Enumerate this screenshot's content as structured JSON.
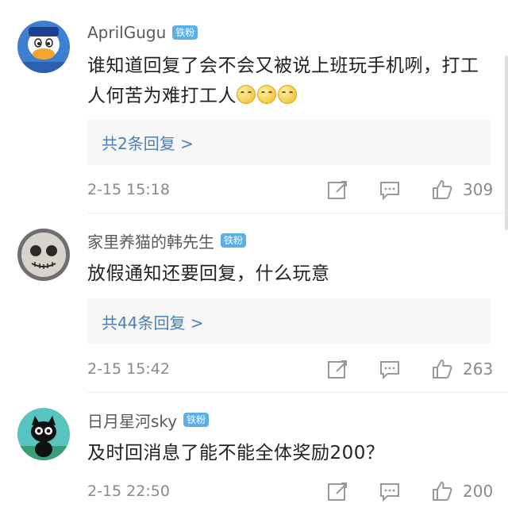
{
  "comments": [
    {
      "user": "AprilGugu",
      "badge": "铁粉",
      "text": "谁知道回复了会不会又被说上班玩手机咧，打工人何苦为难打工人",
      "emoji_count": 3,
      "replies_label": "共2条回复 >",
      "time": "2-15 15:18",
      "likes": "309",
      "avatar_icon": "donald-duck-avatar"
    },
    {
      "user": "家里养猫的韩先生",
      "badge": "铁粉",
      "text": "放假通知还要回复，什么玩意",
      "replies_label": "共44条回复 >",
      "time": "2-15 15:42",
      "likes": "263",
      "avatar_icon": "emil-mask-avatar"
    },
    {
      "user": "日月星河sky",
      "badge": "铁粉",
      "text": "及时回消息了能不能全体奖励200？",
      "time": "2-15 22:50",
      "likes": "200",
      "avatar_icon": "black-cat-avatar"
    }
  ],
  "colors": {
    "link": "#4a7fb8",
    "badge": "#5aaeea",
    "muted": "#8a8a8a"
  }
}
